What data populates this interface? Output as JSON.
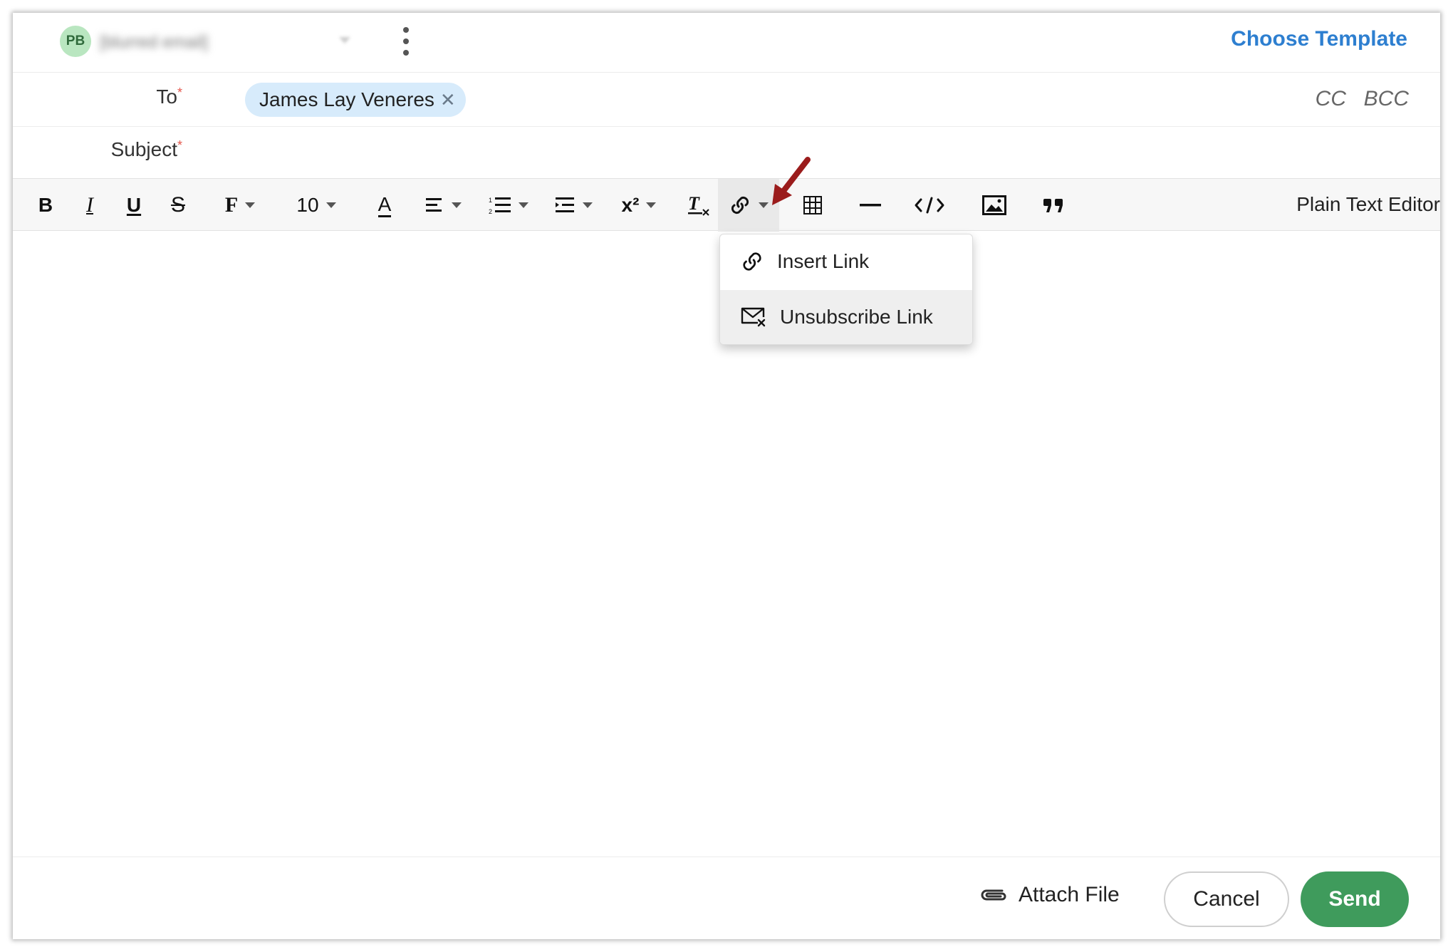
{
  "header": {
    "avatar_initials": "PB",
    "from_address": "[blurred email]",
    "choose_template": "Choose Template"
  },
  "to": {
    "label": "To",
    "required_mark": "*",
    "recipient": "James Lay Veneres",
    "remove_glyph": "✕",
    "cc": "CC",
    "bcc": "BCC"
  },
  "subject": {
    "label": "Subject",
    "required_mark": "*",
    "value": ""
  },
  "toolbar": {
    "bold": "B",
    "italic": "I",
    "underline": "U",
    "strike": "S",
    "font": "F",
    "font_size": "10",
    "font_color": "A",
    "superscript": "x²",
    "plain_text_editor": "Plain Text Editor"
  },
  "link_menu": {
    "items": [
      {
        "label": "Insert Link",
        "icon": "link-icon"
      },
      {
        "label": "Unsubscribe Link",
        "icon": "mail-x-icon"
      }
    ]
  },
  "footer": {
    "attach": "Attach File",
    "cancel": "Cancel",
    "send": "Send"
  },
  "colors": {
    "accent_blue": "#2e7fd0",
    "send_green": "#3f9b5c",
    "chip_blue": "#d7ebfb",
    "required_red": "#e4574c",
    "annotation_arrow": "#9b1c1c"
  }
}
